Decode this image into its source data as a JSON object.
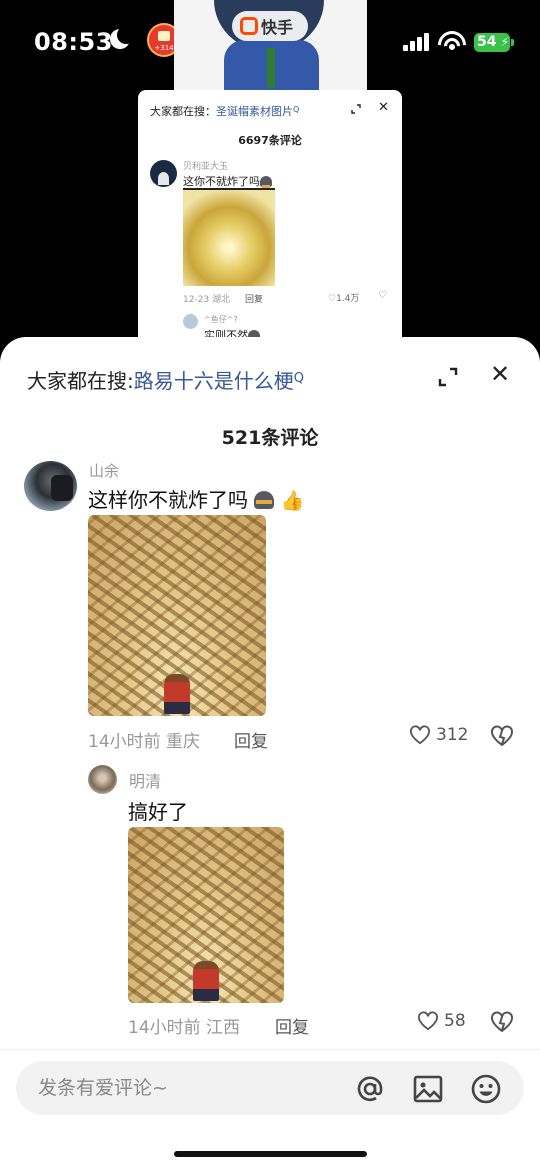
{
  "status_bar": {
    "time": "08:53",
    "red_packet_badge": "+314",
    "battery": "54"
  },
  "video": {
    "brand_name": "快手"
  },
  "mini_panel": {
    "search_prefix": "大家都在搜：",
    "search_term": "圣诞帽素材图片",
    "search_mark": "Q",
    "comment_count": "6697条评论",
    "comment": {
      "user": "贝利亚大玉",
      "text": "这你不就炸了吗",
      "meta": "12-23 湖北",
      "reply": "回复",
      "likes": "1.4万"
    },
    "sub_comment": {
      "user": "^鱼仔^?",
      "text": "实则不然"
    }
  },
  "sheet": {
    "search_prefix": "大家都在搜:",
    "search_term": "路易十六是什么梗",
    "search_mark": "Q",
    "comment_count": "521条评论",
    "comments": [
      {
        "user": "山余",
        "text": "这样你不就炸了吗",
        "time": "14小时前",
        "location": "重庆",
        "reply": "回复",
        "likes": "312"
      },
      {
        "user": "明清",
        "text": "搞好了",
        "time": "14小时前",
        "location": "江西",
        "reply": "回复",
        "likes": "58"
      }
    ],
    "input_placeholder": "发条有爱评论~"
  },
  "colors": {
    "hot_search_blue": "#385898",
    "text_primary": "#111111",
    "text_secondary": "#999999",
    "brand_orange": "#ff4906"
  }
}
